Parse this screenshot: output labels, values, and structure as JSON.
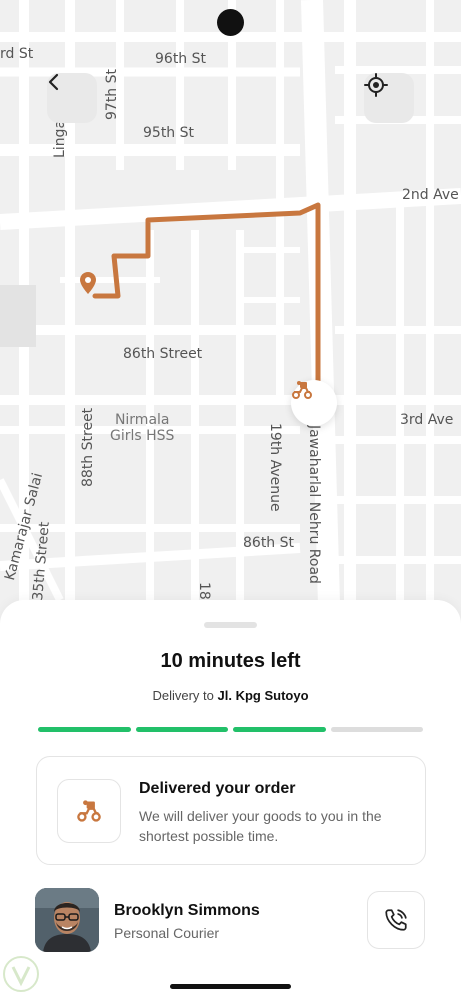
{
  "map": {
    "street_labels": {
      "s1": "rd St",
      "s2": "96th St",
      "s3": "97th St",
      "s4": "95th St",
      "s5": "Linga",
      "s6": "2nd Ave",
      "s7": "86th Street",
      "s8": "3rd Ave",
      "s9": "88th Street",
      "s10": "19th Avenue",
      "s11": "Jawaharlal Nehru Road",
      "s12": "Kamarajar Salai",
      "s13": "35th Street",
      "s14": "86th St",
      "s15": "18"
    },
    "poi_label": "Nirmala\nGirls HSS",
    "route_color": "#c8773f"
  },
  "icons": {
    "back": "chevron-left-icon",
    "locate": "crosshair-icon",
    "pin": "map-pin-icon",
    "courier": "delivery-scooter-icon",
    "call": "phone-icon"
  },
  "delivery": {
    "title": "10 minutes left",
    "subtitle_prefix": "Delivery to",
    "address": "Jl. Kpg Sutoyo",
    "progress_total": 4,
    "progress_done": 3,
    "progress_color": "#22c069"
  },
  "status": {
    "title": "Delivered your order",
    "description": "We will deliver your goods to you in the shortest possible time."
  },
  "courier": {
    "name": "Brooklyn Simmons",
    "role": "Personal Courier"
  }
}
